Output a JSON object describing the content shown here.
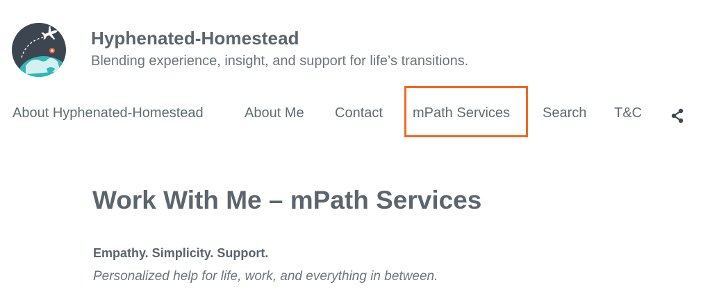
{
  "site": {
    "title": "Hyphenated-Homestead",
    "tagline": "Blending experience, insight, and support for life’s transitions."
  },
  "nav": {
    "items": [
      {
        "label": "About Hyphenated-Homestead"
      },
      {
        "label": "About Me"
      },
      {
        "label": "Contact"
      },
      {
        "label": "mPath Services"
      },
      {
        "label": "Search"
      },
      {
        "label": "T&C"
      }
    ],
    "share_icon": "share-icon"
  },
  "highlight": {
    "color": "#f26722",
    "target": "mPath Services"
  },
  "logo": {
    "icon": "globe-airplane-logo",
    "colors": {
      "background": "#3d4550",
      "ocean": "#2fb8b5",
      "land": "#e9f5f5",
      "pin": "#e8673c"
    }
  },
  "main": {
    "page_title": "Work With Me – mPath Services",
    "intro_heading": "Empathy. Simplicity. Support.",
    "intro_sub": "Personalized help for life, work, and everything in between."
  }
}
